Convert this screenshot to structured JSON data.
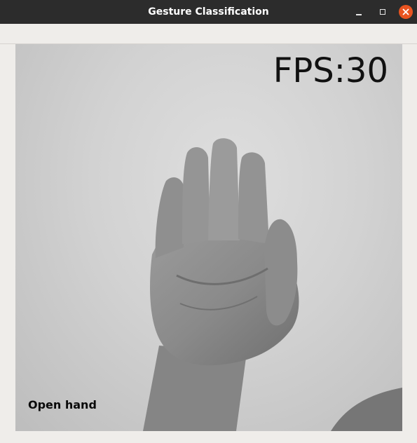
{
  "window": {
    "title": "Gesture Classification",
    "controls": {
      "minimize_icon": "minimize-icon",
      "maximize_icon": "maximize-icon",
      "close_icon": "close-icon",
      "close_color": "#e95420"
    }
  },
  "video": {
    "fps_text": "FPS:30",
    "prediction_label": "Open hand"
  }
}
